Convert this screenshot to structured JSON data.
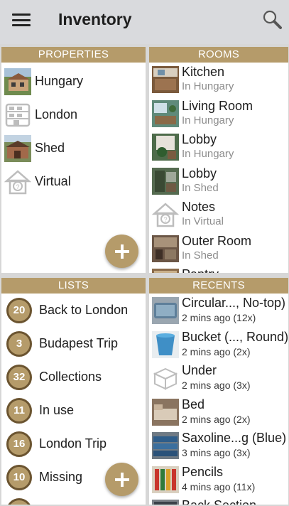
{
  "app": {
    "title": "Inventory"
  },
  "icons": {
    "menu": "menu-icon",
    "search": "search-icon",
    "add": "plus-icon"
  },
  "colors": {
    "accent": "#b59b6a",
    "badge_border": "#6b5430",
    "appbar": "#d9dadd"
  },
  "properties": {
    "header": "PROPERTIES",
    "items": [
      {
        "label": "Hungary"
      },
      {
        "label": "London"
      },
      {
        "label": "Shed"
      },
      {
        "label": "Virtual"
      }
    ]
  },
  "rooms": {
    "header": "ROOMS",
    "items": [
      {
        "title": "Kitchen",
        "subtitle": "In Hungary"
      },
      {
        "title": "Living Room",
        "subtitle": "In Hungary"
      },
      {
        "title": "Lobby",
        "subtitle": "In Hungary"
      },
      {
        "title": "Lobby",
        "subtitle": "In Shed"
      },
      {
        "title": "Notes",
        "subtitle": "In Virtual"
      },
      {
        "title": "Outer Room",
        "subtitle": "In Shed"
      },
      {
        "title": "Pantry",
        "subtitle": ""
      }
    ]
  },
  "lists": {
    "header": "LISTS",
    "items": [
      {
        "count": "20",
        "label": "Back to London"
      },
      {
        "count": "3",
        "label": "Budapest Trip"
      },
      {
        "count": "32",
        "label": "Collections"
      },
      {
        "count": "11",
        "label": "In use"
      },
      {
        "count": "16",
        "label": "London Trip"
      },
      {
        "count": "10",
        "label": "Missing"
      },
      {
        "count": "",
        "label": ""
      }
    ]
  },
  "recents": {
    "header": "RECENTS",
    "items": [
      {
        "title": "Circular..., No-top)",
        "subtitle": "2 mins ago (12x)"
      },
      {
        "title": "Bucket (..., Round)",
        "subtitle": "2 mins ago (2x)"
      },
      {
        "title": "Under",
        "subtitle": "2 mins ago (3x)"
      },
      {
        "title": "Bed",
        "subtitle": "2 mins ago (2x)"
      },
      {
        "title": "Saxoline...g (Blue)",
        "subtitle": "3 mins ago (3x)"
      },
      {
        "title": "Pencils",
        "subtitle": "4 mins ago (11x)"
      },
      {
        "title": "Back Section",
        "subtitle": ""
      }
    ]
  }
}
